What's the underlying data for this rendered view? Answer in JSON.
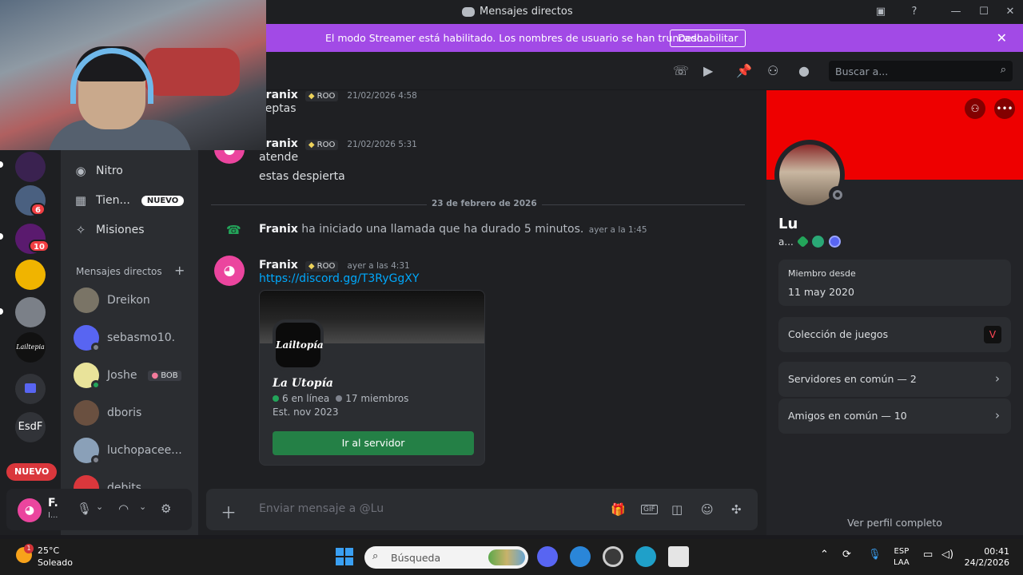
{
  "window": {
    "title": "Mensajes directos"
  },
  "banner": {
    "message": "El modo Streamer está habilitado. Los nombres de usuario se han truncado.",
    "button": "Deshabilitar"
  },
  "rail": {
    "badges": [
      "6",
      "10"
    ],
    "labels": [
      "Lailtepia",
      "EsdF"
    ],
    "new_pill": "NUEVO"
  },
  "sidebar": {
    "nav": [
      {
        "label": "Nitro",
        "icon": "nitro-icon"
      },
      {
        "label": "Tien...",
        "icon": "shop-icon",
        "badge": "NUEVO"
      },
      {
        "label": "Misiones",
        "icon": "quests-icon"
      }
    ],
    "dm_header": "Mensajes directos",
    "dms": [
      {
        "name": "Dreikon"
      },
      {
        "name": "sebasmo10."
      },
      {
        "name": "Joshe",
        "tag": "BOB"
      },
      {
        "name": "dboris"
      },
      {
        "name": "luchopacee..."
      },
      {
        "name": "debits"
      }
    ]
  },
  "user_panel": {
    "name": "F.",
    "status": "I..."
  },
  "header": {
    "search_placeholder": "Buscar a..."
  },
  "messages": [
    {
      "author": "Franix",
      "tag": "ROO",
      "time": "21/02/2026 4:58",
      "lines": [
        "ceptas"
      ]
    },
    {
      "author": "Franix",
      "tag": "ROO",
      "time": "21/02/2026 5:31",
      "lines": [
        "atende",
        "estas despierta"
      ]
    }
  ],
  "date_divider": "23 de febrero de 2026",
  "call": {
    "author": "Franix",
    "text": "ha iniciado una llamada que ha durado 5 minutos.",
    "time": "ayer a la 1:45"
  },
  "invite_msg": {
    "author": "Franix",
    "tag": "ROO",
    "time": "ayer a las 4:31",
    "link": "https://discord.gg/T3RyGgXY",
    "server": {
      "icon_text": "Lailtopía",
      "name": "La Utopía",
      "online": "6 en línea",
      "members": "17 miembros",
      "established": "Est. nov 2023",
      "join": "Ir al servidor"
    }
  },
  "composer": {
    "placeholder": "Enviar mensaje a @Lu"
  },
  "profile": {
    "display_name": "Lu",
    "username": "a...",
    "member_since_label": "Miembro desde",
    "member_since": "11 may 2020",
    "games": "Colección de juegos",
    "mutual_servers": "Servidores en común — 2",
    "mutual_friends": "Amigos en común — 10",
    "view_full": "Ver perfil completo",
    "banner_color": "#ee0000"
  },
  "taskbar": {
    "weather_badge": "1",
    "temperature": "25°C",
    "condition": "Soleado",
    "search": "Búsqueda",
    "lang_top": "ESP",
    "lang_bottom": "LAA",
    "time": "00:41",
    "date": "24/2/2026"
  },
  "colors": {
    "accent": "#a24ae6",
    "discord_pink": "#eb459e",
    "join_green": "#248046",
    "link": "#00a8fc"
  }
}
